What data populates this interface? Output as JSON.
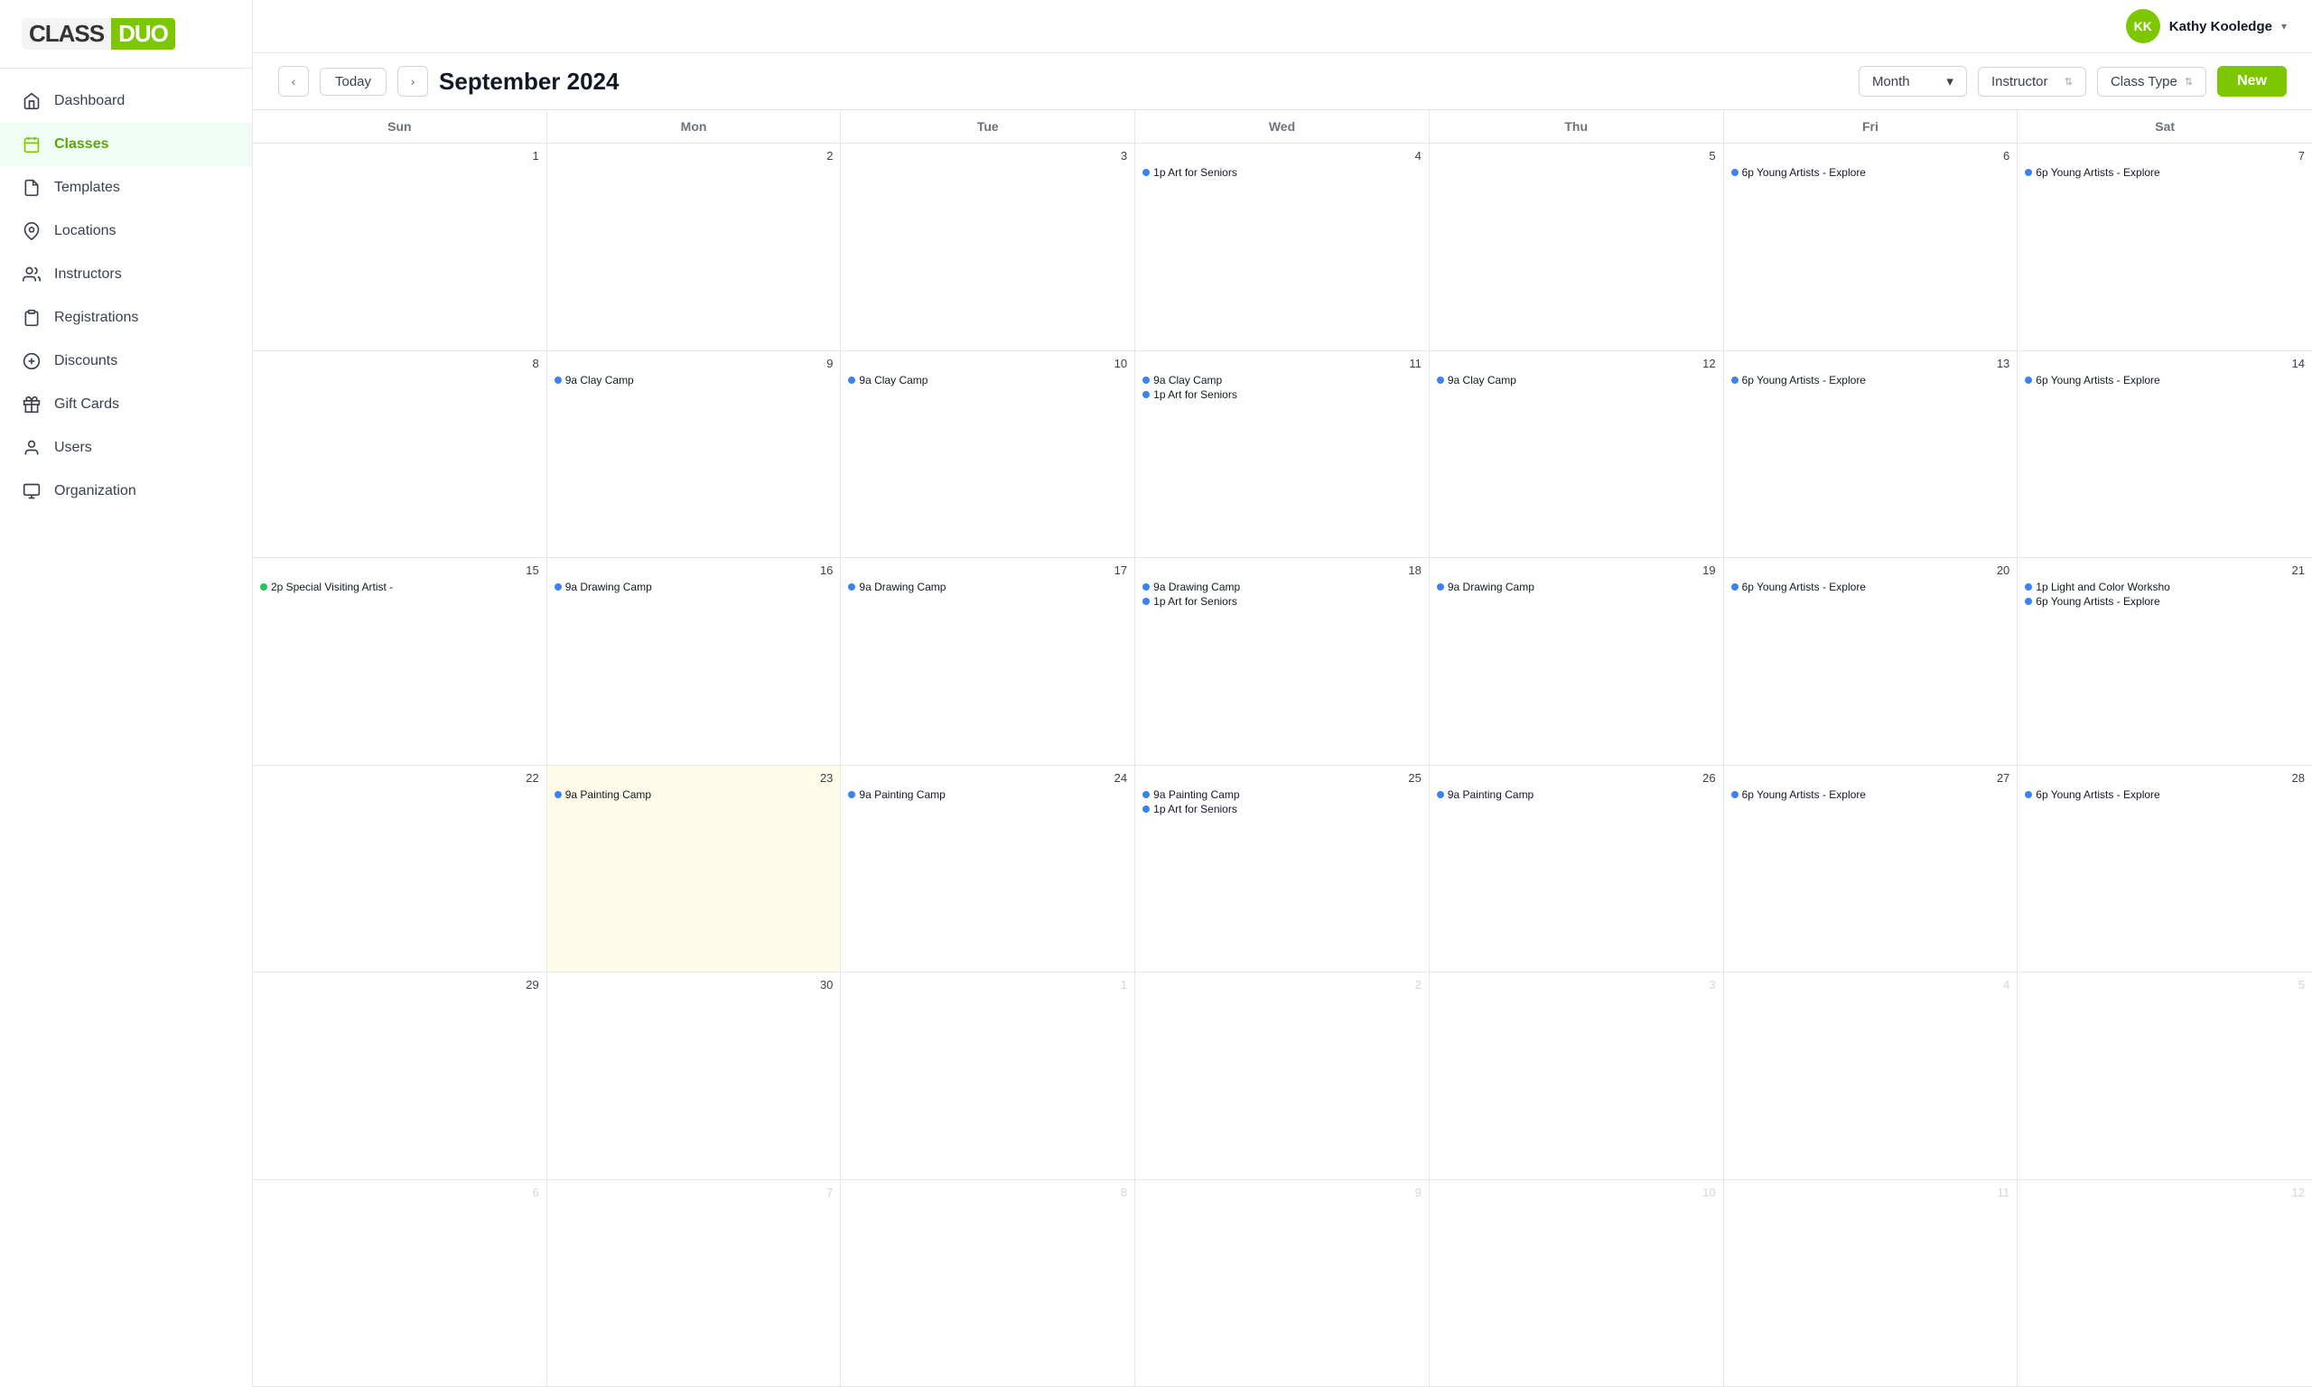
{
  "app": {
    "logo_class": "CLASS",
    "logo_duo": "DUO"
  },
  "user": {
    "initials": "KK",
    "name": "Kathy Kooledge"
  },
  "sidebar": {
    "items": [
      {
        "id": "dashboard",
        "label": "Dashboard",
        "icon": "home",
        "active": false
      },
      {
        "id": "classes",
        "label": "Classes",
        "icon": "calendar",
        "active": true
      },
      {
        "id": "templates",
        "label": "Templates",
        "icon": "file",
        "active": false
      },
      {
        "id": "locations",
        "label": "Locations",
        "icon": "map-pin",
        "active": false
      },
      {
        "id": "instructors",
        "label": "Instructors",
        "icon": "users",
        "active": false
      },
      {
        "id": "registrations",
        "label": "Registrations",
        "icon": "clipboard",
        "active": false
      },
      {
        "id": "discounts",
        "label": "Discounts",
        "icon": "tag",
        "active": false
      },
      {
        "id": "gift-cards",
        "label": "Gift Cards",
        "icon": "gift",
        "active": false
      },
      {
        "id": "users",
        "label": "Users",
        "icon": "user",
        "active": false
      },
      {
        "id": "organization",
        "label": "Organization",
        "icon": "building",
        "active": false
      }
    ]
  },
  "calendar": {
    "title": "September 2024",
    "view": "Month",
    "instructor_filter": "Instructor",
    "class_type_filter": "Class Type",
    "new_button": "New",
    "today_button": "Today",
    "days": [
      "Sun",
      "Mon",
      "Tue",
      "Wed",
      "Thu",
      "Fri",
      "Sat"
    ],
    "weeks": [
      {
        "cells": [
          {
            "day": "1",
            "other": false,
            "today": false,
            "events": []
          },
          {
            "day": "2",
            "other": false,
            "today": false,
            "events": []
          },
          {
            "day": "3",
            "other": false,
            "today": false,
            "events": []
          },
          {
            "day": "4",
            "other": false,
            "today": false,
            "events": [
              {
                "dot": "blue",
                "time": "1p",
                "title": "Art for Seniors"
              }
            ]
          },
          {
            "day": "5",
            "other": false,
            "today": false,
            "events": []
          },
          {
            "day": "6",
            "other": false,
            "today": false,
            "events": [
              {
                "dot": "blue",
                "time": "6p",
                "title": "Young Artists - Explore"
              }
            ]
          },
          {
            "day": "7",
            "other": false,
            "today": false,
            "events": [
              {
                "dot": "blue",
                "time": "6p",
                "title": "Young Artists - Explore"
              }
            ]
          }
        ]
      },
      {
        "cells": [
          {
            "day": "8",
            "other": false,
            "today": false,
            "events": []
          },
          {
            "day": "9",
            "other": false,
            "today": false,
            "events": [
              {
                "dot": "blue",
                "time": "9a",
                "title": "Clay Camp"
              }
            ]
          },
          {
            "day": "10",
            "other": false,
            "today": false,
            "events": [
              {
                "dot": "blue",
                "time": "9a",
                "title": "Clay Camp"
              }
            ]
          },
          {
            "day": "11",
            "other": false,
            "today": false,
            "events": [
              {
                "dot": "blue",
                "time": "9a",
                "title": "Clay Camp"
              },
              {
                "dot": "blue",
                "time": "1p",
                "title": "Art for Seniors"
              }
            ]
          },
          {
            "day": "12",
            "other": false,
            "today": false,
            "events": [
              {
                "dot": "blue",
                "time": "9a",
                "title": "Clay Camp"
              }
            ]
          },
          {
            "day": "13",
            "other": false,
            "today": false,
            "events": [
              {
                "dot": "blue",
                "time": "6p",
                "title": "Young Artists - Explore"
              }
            ]
          },
          {
            "day": "14",
            "other": false,
            "today": false,
            "events": [
              {
                "dot": "blue",
                "time": "6p",
                "title": "Young Artists - Explore"
              }
            ]
          }
        ]
      },
      {
        "cells": [
          {
            "day": "15",
            "other": false,
            "today": false,
            "events": [
              {
                "dot": "green",
                "time": "2p",
                "title": "Special Visiting Artist -"
              }
            ]
          },
          {
            "day": "16",
            "other": false,
            "today": false,
            "events": [
              {
                "dot": "blue",
                "time": "9a",
                "title": "Drawing Camp"
              }
            ]
          },
          {
            "day": "17",
            "other": false,
            "today": false,
            "events": [
              {
                "dot": "blue",
                "time": "9a",
                "title": "Drawing Camp"
              }
            ]
          },
          {
            "day": "18",
            "other": false,
            "today": false,
            "events": [
              {
                "dot": "blue",
                "time": "9a",
                "title": "Drawing Camp"
              },
              {
                "dot": "blue",
                "time": "1p",
                "title": "Art for Seniors"
              }
            ]
          },
          {
            "day": "19",
            "other": false,
            "today": false,
            "events": [
              {
                "dot": "blue",
                "time": "9a",
                "title": "Drawing Camp"
              }
            ]
          },
          {
            "day": "20",
            "other": false,
            "today": false,
            "events": [
              {
                "dot": "blue",
                "time": "6p",
                "title": "Young Artists - Explore"
              }
            ]
          },
          {
            "day": "21",
            "other": false,
            "today": false,
            "events": [
              {
                "dot": "blue",
                "time": "1p",
                "title": "Light and Color Worksho"
              },
              {
                "dot": "blue",
                "time": "6p",
                "title": "Young Artists - Explore"
              }
            ]
          }
        ]
      },
      {
        "cells": [
          {
            "day": "22",
            "other": false,
            "today": false,
            "events": []
          },
          {
            "day": "23",
            "other": false,
            "today": true,
            "events": [
              {
                "dot": "blue",
                "time": "9a",
                "title": "Painting Camp"
              }
            ]
          },
          {
            "day": "24",
            "other": false,
            "today": false,
            "events": [
              {
                "dot": "blue",
                "time": "9a",
                "title": "Painting Camp"
              }
            ]
          },
          {
            "day": "25",
            "other": false,
            "today": false,
            "events": [
              {
                "dot": "blue",
                "time": "9a",
                "title": "Painting Camp"
              },
              {
                "dot": "blue",
                "time": "1p",
                "title": "Art for Seniors"
              }
            ]
          },
          {
            "day": "26",
            "other": false,
            "today": false,
            "events": [
              {
                "dot": "blue",
                "time": "9a",
                "title": "Painting Camp"
              }
            ]
          },
          {
            "day": "27",
            "other": false,
            "today": false,
            "events": [
              {
                "dot": "blue",
                "time": "6p",
                "title": "Young Artists - Explore"
              }
            ]
          },
          {
            "day": "28",
            "other": false,
            "today": false,
            "events": [
              {
                "dot": "blue",
                "time": "6p",
                "title": "Young Artists - Explore"
              }
            ]
          }
        ]
      },
      {
        "cells": [
          {
            "day": "29",
            "other": false,
            "today": false,
            "events": []
          },
          {
            "day": "30",
            "other": false,
            "today": false,
            "events": []
          },
          {
            "day": "1",
            "other": true,
            "today": false,
            "events": []
          },
          {
            "day": "2",
            "other": true,
            "today": false,
            "events": []
          },
          {
            "day": "3",
            "other": true,
            "today": false,
            "events": []
          },
          {
            "day": "4",
            "other": true,
            "today": false,
            "events": []
          },
          {
            "day": "5",
            "other": true,
            "today": false,
            "events": []
          }
        ]
      },
      {
        "cells": [
          {
            "day": "6",
            "other": true,
            "today": false,
            "events": []
          },
          {
            "day": "7",
            "other": true,
            "today": false,
            "events": []
          },
          {
            "day": "8",
            "other": true,
            "today": false,
            "events": []
          },
          {
            "day": "9",
            "other": true,
            "today": false,
            "events": []
          },
          {
            "day": "10",
            "other": true,
            "today": false,
            "events": []
          },
          {
            "day": "11",
            "other": true,
            "today": false,
            "events": []
          },
          {
            "day": "12",
            "other": true,
            "today": false,
            "events": []
          }
        ]
      }
    ]
  }
}
